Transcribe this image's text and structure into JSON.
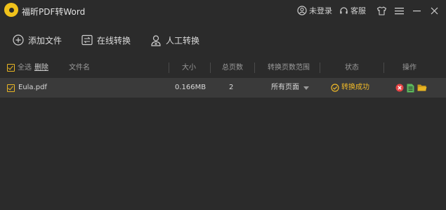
{
  "app": {
    "title": "福昕PDF转Word"
  },
  "titlebar": {
    "login_label": "未登录",
    "service_label": "客服"
  },
  "toolbar": {
    "add_file_label": "添加文件",
    "online_convert_label": "在线转换",
    "manual_convert_label": "人工转换"
  },
  "table": {
    "select_all_label": "全选",
    "delete_label": "删除",
    "columns": {
      "filename": "文件名",
      "size": "大小",
      "total_pages": "总页数",
      "page_range": "转换页数范围",
      "status": "状态",
      "actions": "操作"
    },
    "rows": [
      {
        "filename": "Eula.pdf",
        "size": "0.166MB",
        "total_pages": "2",
        "page_range": "所有页面",
        "status": "转换成功"
      }
    ]
  },
  "colors": {
    "accent": "#f0c21b",
    "background": "#2b2b2b",
    "row_bg": "#3a3a3a",
    "delete_red": "#e84545",
    "doc_green": "#5cb85c",
    "folder_yellow": "#e8b523"
  }
}
